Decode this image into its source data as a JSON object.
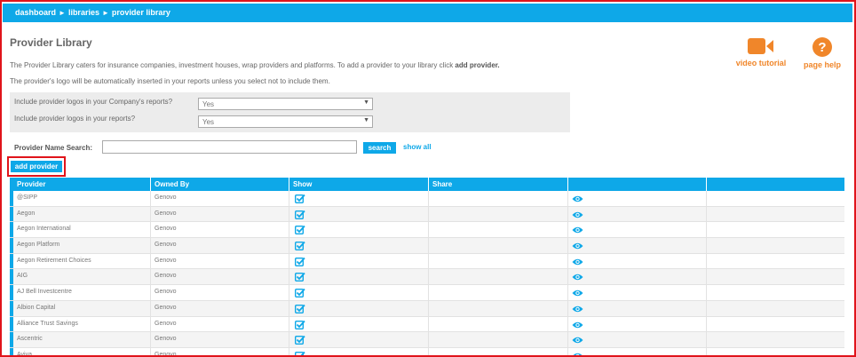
{
  "breadcrumb": {
    "dashboard": "dashboard",
    "libraries": "libraries",
    "current": "provider library",
    "separator": "►"
  },
  "page": {
    "title": "Provider Library",
    "intro_text": "The Provider Library caters for insurance companies, investment houses, wrap providers and platforms. To add a provider to your library click ",
    "intro_bold": "add provider.",
    "intro_text2": "The provider's logo will be automatically inserted in your reports unless you select not to include them."
  },
  "help": {
    "video_label": "video tutorial",
    "page_help_label": "page help",
    "video_icon": "video-camera-icon",
    "help_icon": "question-circle-icon"
  },
  "options": {
    "company_logos_label": "Include provider logos in your Company's reports?",
    "company_logos_value": "Yes",
    "your_logos_label": "Include provider logos in your reports?",
    "your_logos_value": "Yes"
  },
  "search": {
    "label": "Provider Name Search:",
    "value": "",
    "button": "search",
    "show_all": "show all"
  },
  "add_provider": "add provider",
  "table": {
    "headers": [
      "Provider",
      "Owned By",
      "Show",
      "Share",
      "",
      ""
    ],
    "rows": [
      {
        "provider": "@SIPP",
        "owned_by": "Genovo",
        "show": true
      },
      {
        "provider": "Aegon",
        "owned_by": "Genovo",
        "show": true
      },
      {
        "provider": "Aegon International",
        "owned_by": "Genovo",
        "show": true
      },
      {
        "provider": "Aegon Platform",
        "owned_by": "Genovo",
        "show": true
      },
      {
        "provider": "Aegon Retirement Choices",
        "owned_by": "Genovo",
        "show": true
      },
      {
        "provider": "AIG",
        "owned_by": "Genovo",
        "show": true
      },
      {
        "provider": "AJ Bell Investcentre",
        "owned_by": "Genovo",
        "show": true
      },
      {
        "provider": "Albion Capital",
        "owned_by": "Genovo",
        "show": true
      },
      {
        "provider": "Alliance Trust Savings",
        "owned_by": "Genovo",
        "show": true
      },
      {
        "provider": "Ascentric",
        "owned_by": "Genovo",
        "show": true
      },
      {
        "provider": "Aviva",
        "owned_by": "Genovo",
        "show": true
      }
    ]
  },
  "colors": {
    "accent": "#0ea8e8",
    "help_orange": "#f0862a",
    "highlight_red": "#e0141b"
  }
}
